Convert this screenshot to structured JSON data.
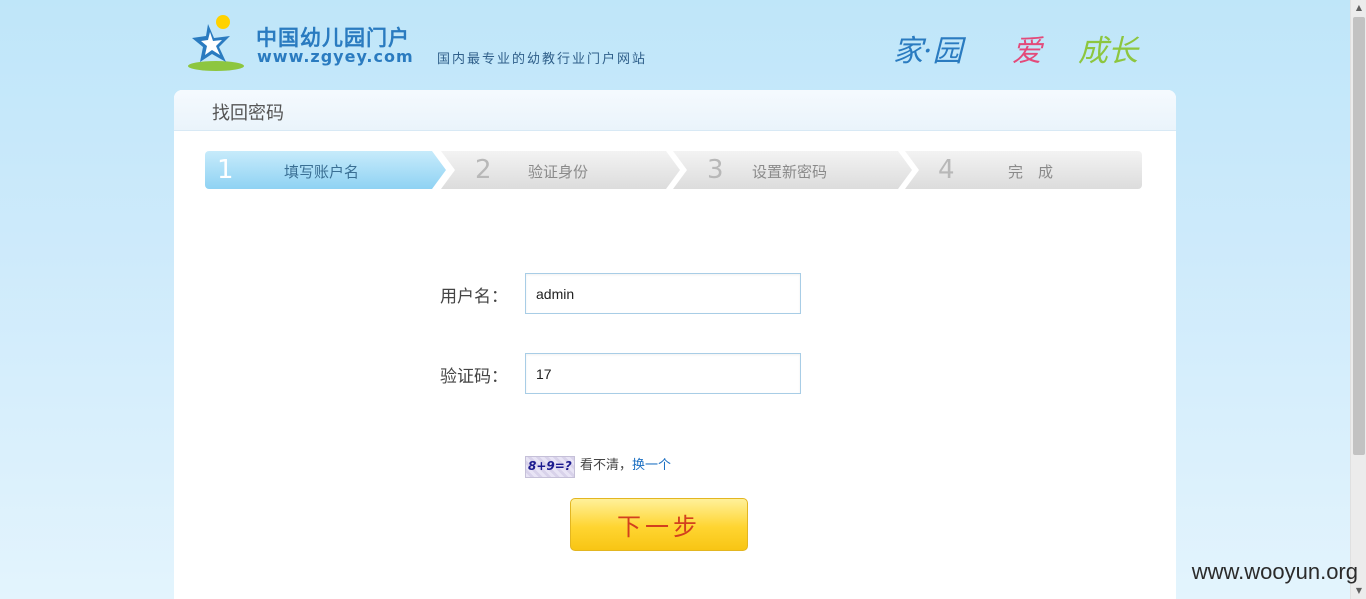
{
  "header": {
    "brand_cn": "中国幼儿园门户",
    "brand_url": "www.zgyey.com",
    "slogan": "国内最专业的幼教行业门户网站",
    "motto_part1": "家·园",
    "motto_part2": "爱",
    "motto_part3": "成长"
  },
  "panel": {
    "title": "找回密码"
  },
  "steps": [
    {
      "number": "1",
      "label": "填写账户名",
      "active": true
    },
    {
      "number": "2",
      "label": "验证身份",
      "active": false
    },
    {
      "number": "3",
      "label": "设置新密码",
      "active": false
    },
    {
      "number": "4",
      "label": "完　成",
      "active": false
    }
  ],
  "form": {
    "username_label": "用户名：",
    "username_value": "admin",
    "captcha_label": "验证码：",
    "captcha_value": "17",
    "captcha_image_text": "8+9=?",
    "captcha_hint": "看不清，",
    "captcha_refresh": "换一个",
    "next_button": "下一步"
  },
  "watermark": "www.wooyun.org",
  "colors": {
    "brand_blue": "#2a7bc0",
    "active_step": "#8fd2f3",
    "button_yellow": "#ffd531",
    "button_text": "#d2401e",
    "link_blue": "#1b6fc2"
  }
}
